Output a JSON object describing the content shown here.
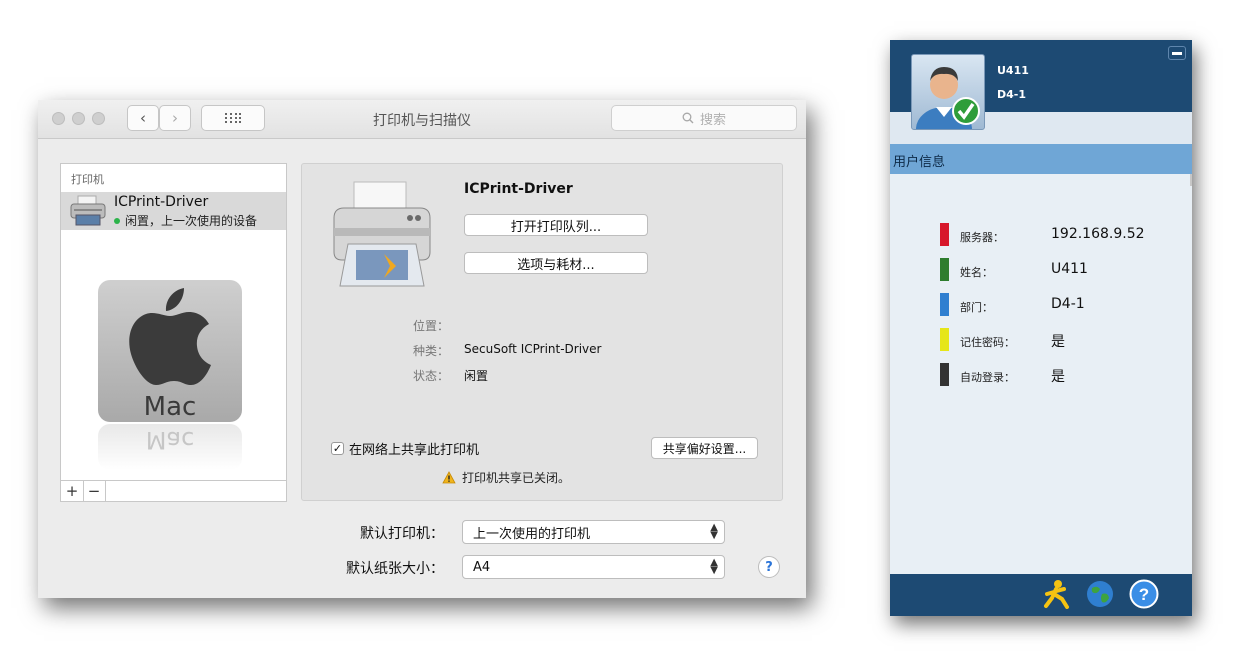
{
  "mac_window": {
    "title": "打印机与扫描仪",
    "search_placeholder": "搜索",
    "list_header": "打印机",
    "printer": {
      "name": "ICPrint-Driver",
      "status": "闲置，上一次使用的设备"
    },
    "logo_text": "Mac",
    "add_label": "+",
    "remove_label": "−",
    "detail": {
      "name": "ICPrint-Driver",
      "open_queue": "打开打印队列...",
      "options_supplies": "选项与耗材...",
      "location_label": "位置：",
      "location_value": "",
      "kind_label": "种类：",
      "kind_value": "SecuSoft ICPrint-Driver",
      "status_label": "状态：",
      "status_value": "闲置",
      "share_label": "在网络上共享此打印机",
      "share_checked": true,
      "share_prefs": "共享偏好设置...",
      "share_warning": "打印机共享已关闭。"
    },
    "default_printer_label": "默认打印机：",
    "default_printer_value": "上一次使用的打印机",
    "default_paper_label": "默认纸张大小：",
    "default_paper_value": "A4",
    "help_label": "?"
  },
  "client_panel": {
    "username": "U411",
    "department": "D4-1",
    "section_title": "用户信息",
    "rows": [
      {
        "label": "服务器：",
        "value": "192.168.9.52",
        "color": "#d7172a"
      },
      {
        "label": "姓名：",
        "value": "U411",
        "color": "#2e7d2e"
      },
      {
        "label": "部门：",
        "value": "D4-1",
        "color": "#2f7fd0"
      },
      {
        "label": "记住密码：",
        "value": "是",
        "color": "#e6e619"
      },
      {
        "label": "自动登录：",
        "value": "是",
        "color": "#333333"
      }
    ],
    "footer_icons": [
      "running-person-icon",
      "globe-icon",
      "help-icon"
    ],
    "help_glyph": "?"
  }
}
